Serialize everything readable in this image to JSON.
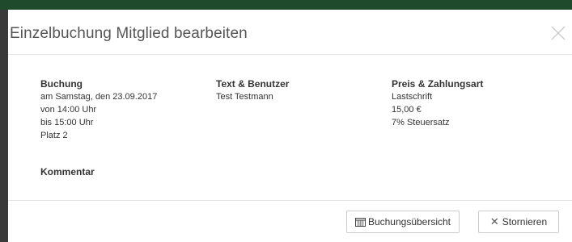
{
  "modal": {
    "title": "Einzelbuchung Mitglied bearbeiten"
  },
  "booking": {
    "heading": "Buchung",
    "lines": [
      "am Samstag, den 23.09.2017",
      "von 14:00 Uhr",
      "bis 15:00 Uhr",
      "Platz 2"
    ]
  },
  "user": {
    "heading": "Text & Benutzer",
    "lines": [
      "Test Testmann"
    ]
  },
  "payment": {
    "heading": "Preis & Zahlungsart",
    "lines": [
      "Lastschrift",
      "15,00 €",
      "7% Steuersatz"
    ]
  },
  "comment": {
    "heading": "Kommentar"
  },
  "footer": {
    "overview_label": "Buchungsübersicht",
    "overview_icon": "calendar-icon",
    "cancel_label": "Stornieren",
    "cancel_icon": "close-icon"
  },
  "colors": {
    "topbar": "#1f4a2c",
    "backdrop": "#3a3a3a"
  }
}
